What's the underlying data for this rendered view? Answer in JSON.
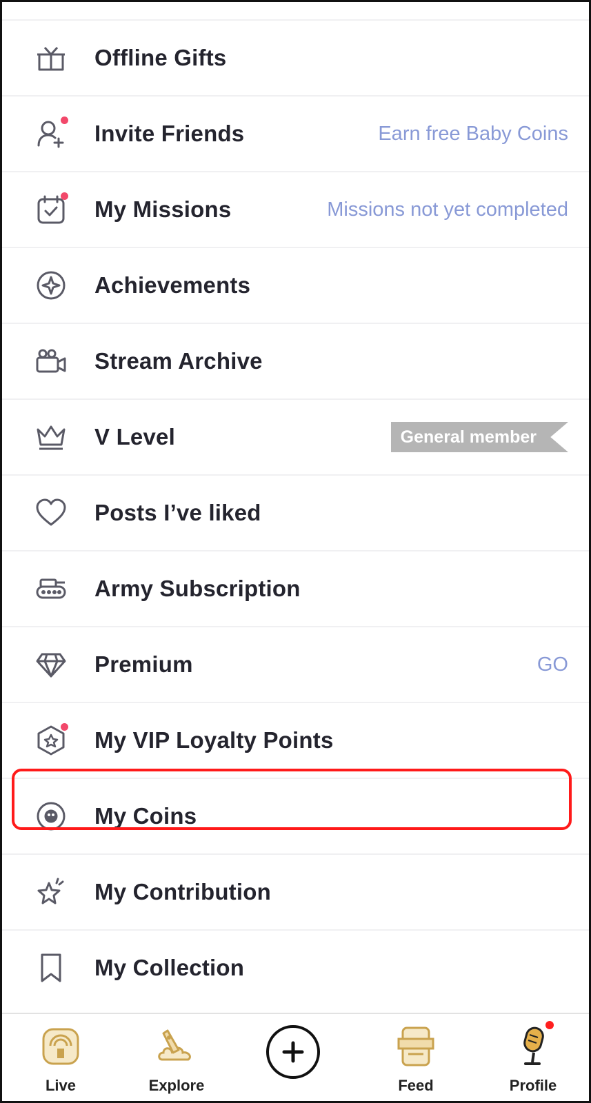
{
  "menu": {
    "items": [
      {
        "label": "Offline Gifts"
      },
      {
        "label": "Invite Friends",
        "aside": "Earn free Baby Coins"
      },
      {
        "label": "My Missions",
        "aside": "Missions not yet completed"
      },
      {
        "label": "Achievements"
      },
      {
        "label": "Stream Archive"
      },
      {
        "label": "V Level",
        "badge": "General member"
      },
      {
        "label": "Posts I’ve liked"
      },
      {
        "label": "Army Subscription"
      },
      {
        "label": "Premium",
        "aside": "GO"
      },
      {
        "label": "My VIP Loyalty Points"
      },
      {
        "label": "My Coins"
      },
      {
        "label": "My Contribution"
      },
      {
        "label": "My Collection"
      }
    ]
  },
  "tabbar": {
    "live": "Live",
    "explore": "Explore",
    "feed": "Feed",
    "profile": "Profile"
  },
  "colors": {
    "accent_text": "#8899d6",
    "notification_dot": "#f2486a",
    "highlight": "#ff1a1a",
    "tab_icon_gold": "#d9b560",
    "icon_stroke": "#5a5a66"
  }
}
